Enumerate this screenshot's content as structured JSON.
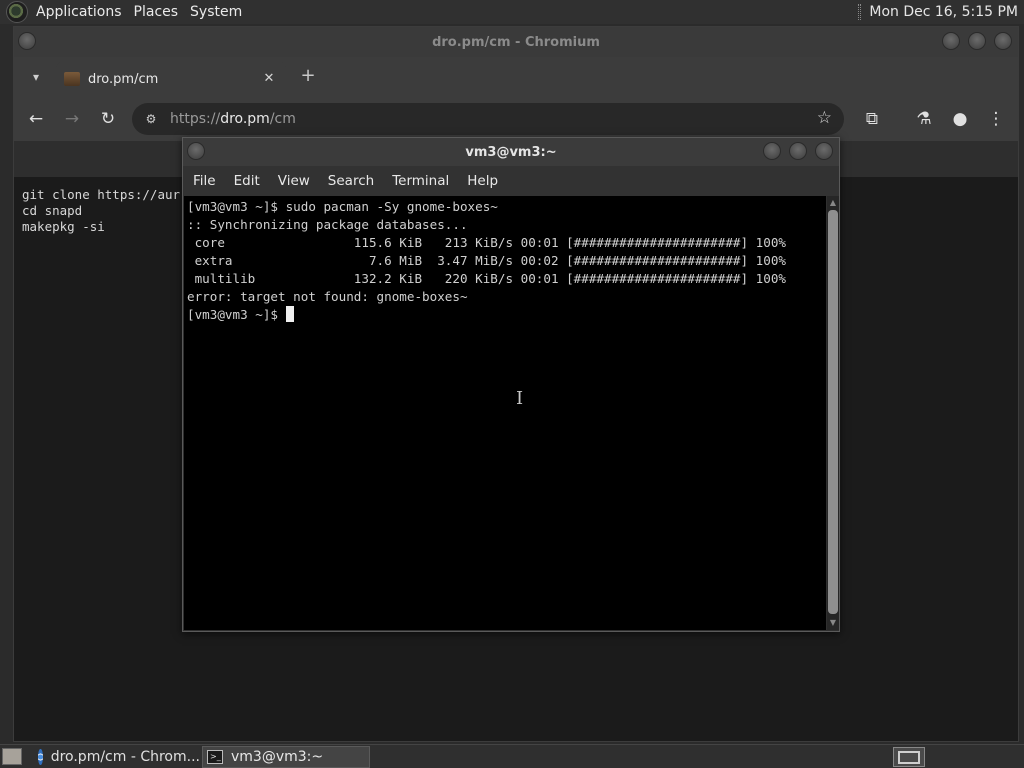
{
  "top_panel": {
    "menus": [
      "Applications",
      "Places",
      "System"
    ],
    "clock": "Mon Dec 16,  5:15 PM"
  },
  "chromium": {
    "window_title": "dro.pm/cm - Chromium",
    "tab": {
      "title": "dro.pm/cm"
    },
    "url": {
      "scheme": "https://",
      "host": "dro.pm",
      "path": "/cm"
    },
    "page_code": [
      "git clone https://aur",
      "cd snapd",
      "makepkg -si"
    ]
  },
  "terminal": {
    "title": "vm3@vm3:~",
    "menu": [
      "File",
      "Edit",
      "View",
      "Search",
      "Terminal",
      "Help"
    ],
    "lines": [
      "[vm3@vm3 ~]$ sudo pacman -Sy gnome-boxes~",
      ":: Synchronizing package databases...",
      " core                 115.6 KiB   213 KiB/s 00:01 [######################] 100%",
      " extra                  7.6 MiB  3.47 MiB/s 00:02 [######################] 100%",
      " multilib             132.2 KiB   220 KiB/s 00:01 [######################] 100%",
      "error: target not found: gnome-boxes~"
    ],
    "prompt": "[vm3@vm3 ~]$ "
  },
  "taskbar": {
    "items": [
      "dro.pm/cm - Chrom...",
      "vm3@vm3:~"
    ]
  },
  "icons": {
    "distro": "distro-logo-icon",
    "tab_search": "chevron-down-icon",
    "back": "arrow-left-icon",
    "forward": "arrow-right-icon",
    "reload": "reload-icon",
    "star": "star-icon",
    "extensions": "puzzle-icon",
    "labs": "flask-icon",
    "profile": "profile-icon",
    "menu": "kebab-menu-icon"
  }
}
